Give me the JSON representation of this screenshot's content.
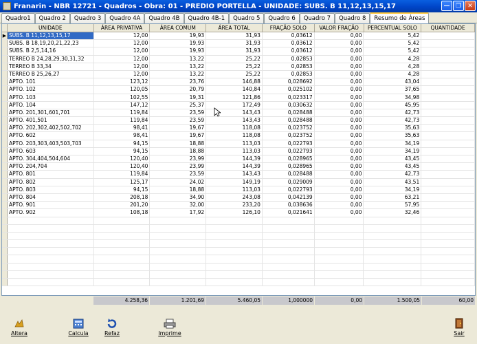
{
  "window": {
    "title": "Franarin - NBR 12721 - Quadros - Obra: 01 - PREDIO PORTELLA - UNIDADE: SUBS. B 11,12,13,15,17"
  },
  "tabs": [
    "Quadro1",
    "Quadro 2",
    "Quadro 3",
    "Quadro 4A",
    "Quadro 4B",
    "Quadro 4B-1",
    "Quadro 5",
    "Quadro 6",
    "Quadro 7",
    "Quadro 8",
    "Resumo de Áreas"
  ],
  "active_tab": 10,
  "grid": {
    "columns": [
      "UNIDADE",
      "ÁREA PRIVATIVA",
      "ÁREA COMUM",
      "ÁREA TOTAL",
      "FRAÇÃO SOLO",
      "VALOR FRAÇÃO",
      "PERCENTUAL SOLO",
      "QUANTIDADE"
    ],
    "rows": [
      [
        "SUBS. B 11,12,13,15,17",
        "12,00",
        "19,93",
        "31,93",
        "0,03612",
        "0,00",
        "5,42",
        ""
      ],
      [
        "SUBS. B 18,19,20,21,22,23",
        "12,00",
        "19,93",
        "31,93",
        "0,03612",
        "0,00",
        "5,42",
        ""
      ],
      [
        "SUBS. B 2,5,14,16",
        "12,00",
        "19,93",
        "31,93",
        "0,03612",
        "0,00",
        "5,42",
        ""
      ],
      [
        "TERREO B 24,28,29,30,31,32",
        "12,00",
        "13,22",
        "25,22",
        "0,02853",
        "0,00",
        "4,28",
        ""
      ],
      [
        "TERREO B 33,34",
        "12,00",
        "13,22",
        "25,22",
        "0,02853",
        "0,00",
        "4,28",
        ""
      ],
      [
        "TERREO B 25,26,27",
        "12,00",
        "13,22",
        "25,22",
        "0,02853",
        "0,00",
        "4,28",
        ""
      ],
      [
        "APTO. 101",
        "123,12",
        "23,76",
        "146,88",
        "0,028692",
        "0,00",
        "43,04",
        ""
      ],
      [
        "APTO. 102",
        "120,05",
        "20,79",
        "140,84",
        "0,025102",
        "0,00",
        "37,65",
        ""
      ],
      [
        "APTO. 103",
        "102,55",
        "19,31",
        "121,86",
        "0,023317",
        "0,00",
        "34,98",
        ""
      ],
      [
        "APTO. 104",
        "147,12",
        "25,37",
        "172,49",
        "0,030632",
        "0,00",
        "45,95",
        ""
      ],
      [
        "APTO. 201,301,601,701",
        "119,84",
        "23,59",
        "143,43",
        "0,028488",
        "0,00",
        "42,73",
        ""
      ],
      [
        "APTO. 401,501",
        "119,84",
        "23,59",
        "143,43",
        "0,028488",
        "0,00",
        "42,73",
        ""
      ],
      [
        "APTO. 202,302,402,502,702",
        "98,41",
        "19,67",
        "118,08",
        "0,023752",
        "0,00",
        "35,63",
        ""
      ],
      [
        "APTO. 602",
        "98,41",
        "19,67",
        "118,08",
        "0,023752",
        "0,00",
        "35,63",
        ""
      ],
      [
        "APTO. 203,303,403,503,703",
        "94,15",
        "18,88",
        "113,03",
        "0,022793",
        "0,00",
        "34,19",
        ""
      ],
      [
        "APTO. 603",
        "94,15",
        "18,88",
        "113,03",
        "0,022793",
        "0,00",
        "34,19",
        ""
      ],
      [
        "APTO. 304,404,504,604",
        "120,40",
        "23,99",
        "144,39",
        "0,028965",
        "0,00",
        "43,45",
        ""
      ],
      [
        "APTO. 204,704",
        "120,40",
        "23,99",
        "144,39",
        "0,028965",
        "0,00",
        "43,45",
        ""
      ],
      [
        "APTO. 801",
        "119,84",
        "23,59",
        "143,43",
        "0,028488",
        "0,00",
        "42,73",
        ""
      ],
      [
        "APTO. 802",
        "125,17",
        "24,02",
        "149,19",
        "0,029009",
        "0,00",
        "43,51",
        ""
      ],
      [
        "APTO. 803",
        "94,15",
        "18,88",
        "113,03",
        "0,022793",
        "0,00",
        "34,19",
        ""
      ],
      [
        "APTO. 804",
        "208,18",
        "34,90",
        "243,08",
        "0,042139",
        "0,00",
        "63,21",
        ""
      ],
      [
        "APTO. 901",
        "201,20",
        "32,00",
        "233,20",
        "0,038636",
        "0,00",
        "57,95",
        ""
      ],
      [
        "APTO. 902",
        "108,18",
        "17,92",
        "126,10",
        "0,021641",
        "0,00",
        "32,46",
        ""
      ]
    ],
    "empty_rows": 9
  },
  "totals": [
    "",
    "4.258,36",
    "1.201,69",
    "5.460,05",
    "1,000000",
    "0,00",
    "1.500,05",
    "60,00"
  ],
  "toolbar": {
    "altera": "Altera",
    "calcula": "Calcula",
    "refaz": "Refaz",
    "imprime": "Imprime",
    "sair": "Sair"
  },
  "colors": {
    "titlebar": "#0a5fe0",
    "selection": "#316ac5",
    "tab_accent": "#ffc83c"
  }
}
